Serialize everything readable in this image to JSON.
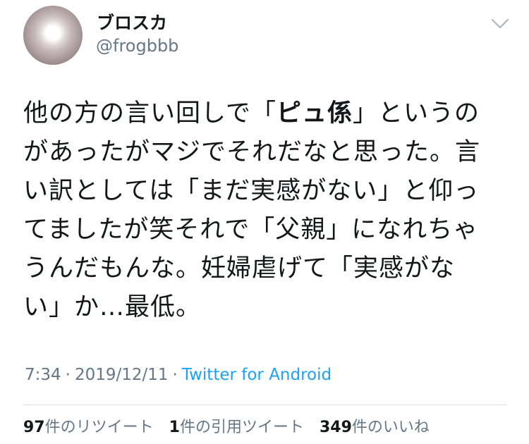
{
  "user": {
    "display_name": "ブロスカ",
    "handle": "@frogbbb",
    "avatar_icon": "avatar-glow-circle"
  },
  "menu": {
    "icon": "chevron-down-icon"
  },
  "tweet": {
    "lines": [
      {
        "pre": "他の方の言い回しで「",
        "bold": "ピュ係",
        "post": "」というの"
      },
      {
        "pre": "があったがマジでそれだなと思った。言",
        "bold": "",
        "post": ""
      },
      {
        "pre": "い訳としては「まだ実感がない」と仰っ",
        "bold": "",
        "post": ""
      },
      {
        "pre": "てましたが笑それで「父親」になれちゃ",
        "bold": "",
        "post": ""
      },
      {
        "pre": "うんだもんな。妊婦虐げて「実感がな",
        "bold": "",
        "post": ""
      },
      {
        "pre": "い」か…最低。",
        "bold": "",
        "post": ""
      }
    ]
  },
  "meta": {
    "time": "7:34",
    "date": "2019/12/11",
    "separator": "·",
    "source": "Twitter for Android"
  },
  "stats": {
    "retweets_count": "97",
    "retweets_label": "件のリツイート",
    "quotes_count": "1",
    "quotes_label": "件の引用ツイート",
    "likes_count": "349",
    "likes_label": "件のいいね"
  },
  "colors": {
    "text": "#14171a",
    "muted": "#657786",
    "accent": "#1da1f2",
    "divider": "#d5dbe0"
  }
}
